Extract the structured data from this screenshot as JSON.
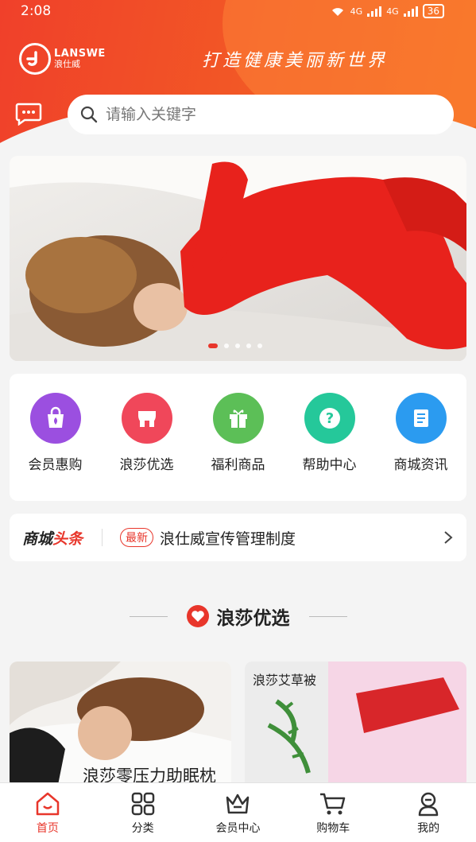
{
  "status_bar": {
    "time": "2:08",
    "network_1": "4G",
    "network_2": "4G",
    "battery": "36"
  },
  "header": {
    "logo_en": "LANSWE",
    "logo_cn": "浪仕威",
    "slogan": "打造健康美丽新世界"
  },
  "search": {
    "placeholder": "请输入关键字"
  },
  "banner": {
    "slides": 5,
    "active_slide": 1
  },
  "quick_menu": [
    {
      "label": "会员惠购",
      "icon": "shopping-bag-icon",
      "color": "#9b4fe0"
    },
    {
      "label": "浪莎优选",
      "icon": "storefront-icon",
      "color": "#f0475a"
    },
    {
      "label": "福利商品",
      "icon": "gift-icon",
      "color": "#5cbf57"
    },
    {
      "label": "帮助中心",
      "icon": "help-icon",
      "color": "#25c89a"
    },
    {
      "label": "商城资讯",
      "icon": "news-icon",
      "color": "#2b9bf0"
    }
  ],
  "ticker": {
    "brand_a": "商城",
    "brand_b": "头条",
    "badge": "最新",
    "headline": "浪仕威宣传管理制度"
  },
  "section": {
    "title": "浪莎优选"
  },
  "products": [
    {
      "name": "浪莎零压力助眠枕"
    },
    {
      "name": "浪莎艾草被"
    }
  ],
  "tabbar": [
    {
      "label": "首页",
      "icon": "home-icon",
      "active": true
    },
    {
      "label": "分类",
      "icon": "grid-icon",
      "active": false
    },
    {
      "label": "会员中心",
      "icon": "crown-icon",
      "active": false
    },
    {
      "label": "购物车",
      "icon": "cart-icon",
      "active": false
    },
    {
      "label": "我的",
      "icon": "user-icon",
      "active": false
    }
  ],
  "colors": {
    "accent": "#e8362b",
    "header_start": "#f0402a",
    "header_end": "#f56b1f"
  }
}
